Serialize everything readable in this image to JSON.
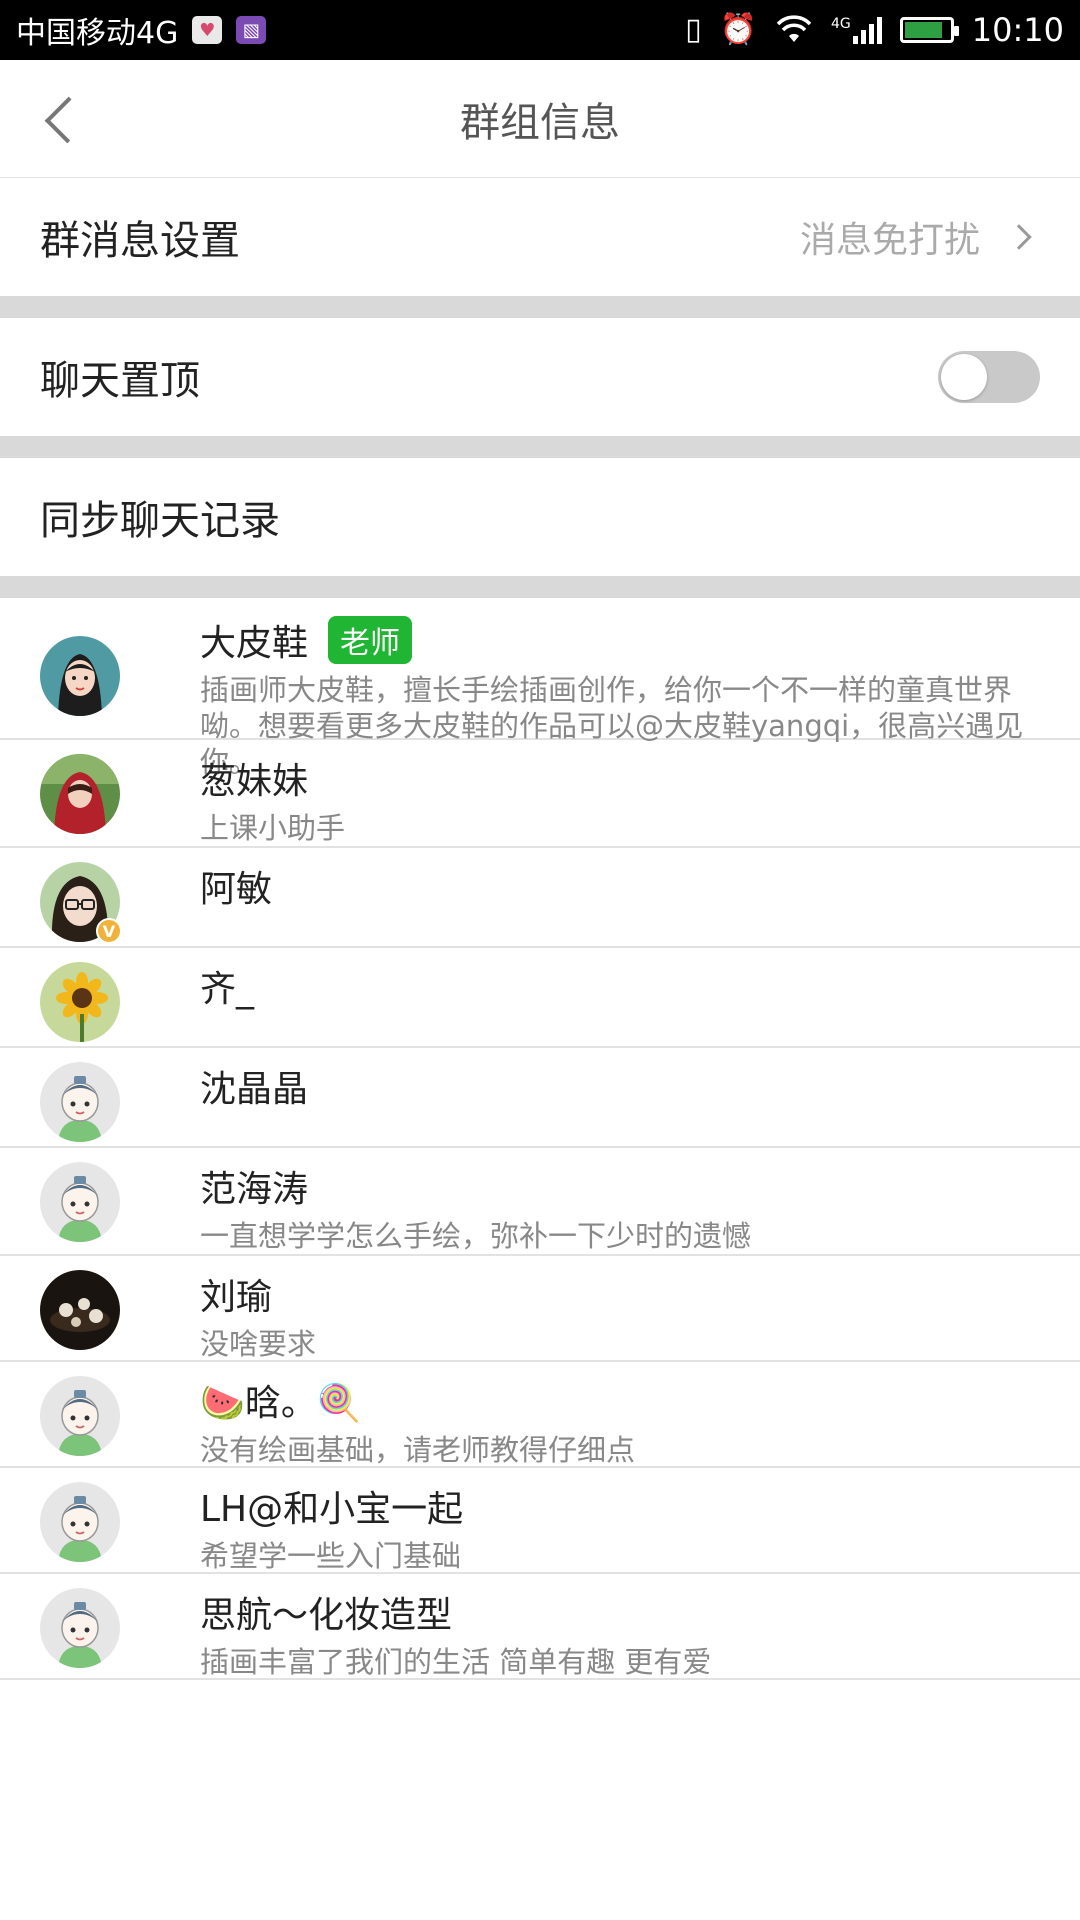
{
  "status_bar": {
    "carrier": "中国移动4G",
    "network_badge": "4G",
    "time": "10:10",
    "icons": [
      "health-app-icon",
      "gallery-app-icon",
      "vibrate-icon",
      "alarm-icon",
      "wifi-icon",
      "cellular-signal-icon",
      "battery-icon"
    ],
    "battery_level": 0.85
  },
  "header": {
    "title": "群组信息",
    "back_icon": "chevron-left-icon"
  },
  "settings": {
    "message_settings": {
      "label": "群消息设置",
      "value": "消息免打扰"
    },
    "pin_chat": {
      "label": "聊天置顶",
      "enabled": false
    },
    "sync_history": {
      "label": "同步聊天记录"
    }
  },
  "members": [
    {
      "name": "大皮鞋",
      "badge": "老师",
      "desc": "插画师大皮鞋，擅长手绘插画创作，给你一个不一样的童真世界呦。想要看更多大皮鞋的作品可以@大皮鞋yangqi，很高兴遇见你。",
      "avatar": "illustrated-girl-avatar"
    },
    {
      "name": "葱妹妹",
      "badge": "",
      "desc": "上课小助手",
      "avatar": "red-hood-girl-avatar"
    },
    {
      "name": "阿敏",
      "badge": "",
      "desc": "",
      "avatar": "glasses-girl-avatar",
      "verified": "V"
    },
    {
      "name": "齐_",
      "badge": "",
      "desc": "",
      "avatar": "sunflower-avatar"
    },
    {
      "name": "沈晶晶",
      "badge": "",
      "desc": "",
      "avatar": "default-cartoon-avatar"
    },
    {
      "name": "范海涛",
      "badge": "",
      "desc": "一直想学学怎么手绘，弥补一下少时的遗憾",
      "avatar": "default-cartoon-avatar"
    },
    {
      "name": "刘瑜",
      "badge": "",
      "desc": "没啥要求",
      "avatar": "tea-set-avatar"
    },
    {
      "name": "🍉晗。🍭",
      "badge": "",
      "desc": "没有绘画基础，请老师教得仔细点",
      "avatar": "default-cartoon-avatar"
    },
    {
      "name": "LH@和小宝一起",
      "badge": "",
      "desc": "希望学一些入门基础",
      "avatar": "default-cartoon-avatar"
    },
    {
      "name": "思航～化妆造型",
      "badge": "",
      "desc": "插画丰富了我们的生活  简单有趣  更有爱",
      "avatar": "default-cartoon-avatar"
    }
  ],
  "colors": {
    "teacher_badge": "#21b534",
    "divider": "#d9d9d9",
    "verified_badge": "#f1b23a"
  }
}
